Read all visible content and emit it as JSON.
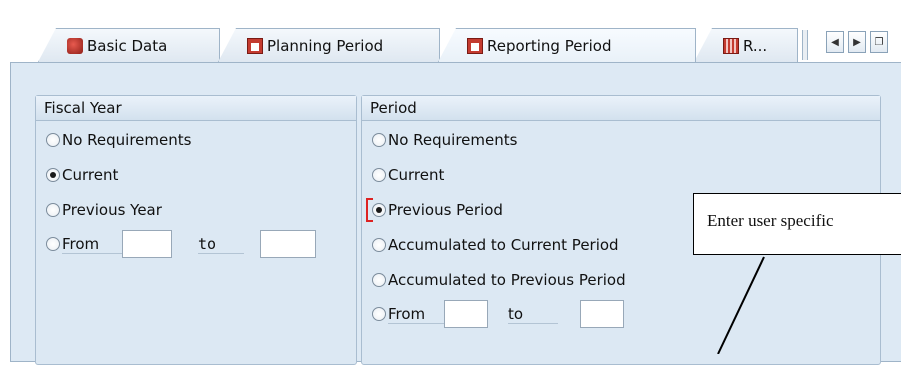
{
  "tabs": [
    {
      "label": "Basic Data",
      "icon": "basic-data-icon"
    },
    {
      "label": "Planning Period",
      "icon": "calendar-icon"
    },
    {
      "label": "Reporting Period",
      "icon": "calendar-icon",
      "active": true
    },
    {
      "label": "R...",
      "icon": "currency-icon"
    }
  ],
  "fiscal_year": {
    "title": "Fiscal Year",
    "options": [
      "No Requirements",
      "Current",
      "Previous Year",
      "From"
    ],
    "selected": "Current",
    "from_value": "",
    "to_label": "to",
    "to_value": ""
  },
  "period": {
    "title": "Period",
    "options": [
      "No Requirements",
      "Current",
      "Previous Period",
      "Accumulated to Current Period",
      "Accumulated to Previous Period",
      "From"
    ],
    "selected": "Previous Period",
    "from_value": "",
    "to_label": "to",
    "to_value": ""
  },
  "callout": {
    "text": "Enter user specific"
  },
  "colors": {
    "panel": "#dde9f4",
    "border": "#9fb4c8",
    "focus": "#d22222"
  }
}
